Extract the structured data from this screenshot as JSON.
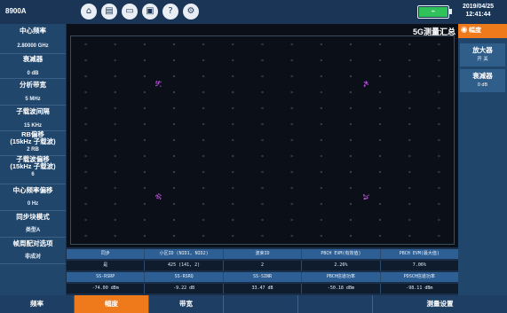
{
  "header": {
    "model": "8900A",
    "icons": [
      "home-icon",
      "message-icon",
      "screen-icon",
      "save-icon",
      "help-icon",
      "settings-icon"
    ],
    "battery_label": "⌁",
    "date": "2019/04/25",
    "time": "12:41:44"
  },
  "sidebar": {
    "items": [
      {
        "label": "中心频率",
        "value": "2.80000 GHz"
      },
      {
        "label": "衰减器",
        "value": "0 dB"
      },
      {
        "label": "分析带宽",
        "value": "5 MHz"
      },
      {
        "label": "子载波间隔",
        "value": "15 KHz"
      },
      {
        "label": "RB偏移\n(15kHz 子载波)",
        "value": "2 RB"
      },
      {
        "label": "子载波偏移\n(15kHz 子载波)",
        "value": "6"
      },
      {
        "label": "中心频率偏移",
        "value": "0 Hz"
      },
      {
        "label": "同步块模式",
        "value": "类型A"
      },
      {
        "label": "帧周配对选项",
        "value": "非成对"
      }
    ]
  },
  "plot": {
    "title": "5G测量汇总"
  },
  "right_panel": {
    "header": "幅度",
    "buttons": [
      {
        "title": "放大器",
        "value": "开    关"
      },
      {
        "title": "衰减器",
        "value": "0 dB"
      }
    ]
  },
  "results": {
    "header1": [
      "同步",
      "小区ID (NID1, NID2)",
      "波束ID",
      "PBCH EVM(有效值)",
      "PBCH EVM(最大值)"
    ],
    "row1": [
      "是",
      "425 (141, 2)",
      "2",
      "2.26%",
      "7.06%"
    ],
    "header2": [
      "SS-RSRP",
      "SS-RSRQ",
      "SS-SINR",
      "PBCH信道功率",
      "PDSCH信道功率"
    ],
    "row2": [
      "-74.00 dBm",
      "-9.22 dB",
      "33.47 dB",
      "-50.18 dBm",
      "-98.11 dBm"
    ]
  },
  "bottom_bar": {
    "buttons": [
      "频率",
      "幅度",
      "带宽",
      "",
      "",
      "测量设置"
    ],
    "active_index": 1
  },
  "colors": {
    "accent": "#ee7a1c",
    "sidebar_bg": "#21466c",
    "plot_bg": "#0b1018",
    "constellation": "#b04bd1"
  },
  "chart_data": {
    "type": "scatter",
    "title": "",
    "xlabel": "",
    "ylabel": "",
    "xlim": [
      -1.3,
      1.3
    ],
    "ylim": [
      -1.3,
      1.3
    ],
    "series": [
      {
        "values": [
          [
            -0.707,
            0.707
          ],
          [
            0.707,
            0.707
          ],
          [
            -0.707,
            -0.707
          ],
          [
            0.707,
            -0.707
          ]
        ]
      }
    ]
  }
}
